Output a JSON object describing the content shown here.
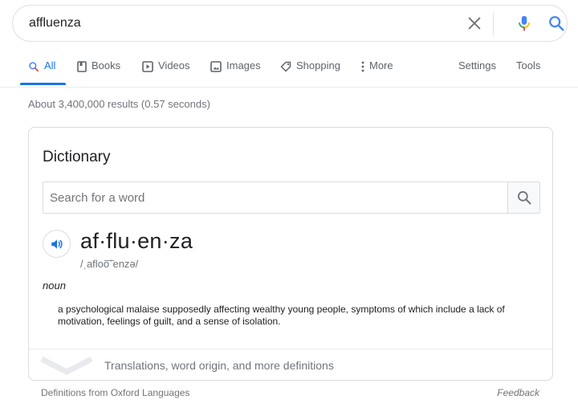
{
  "search": {
    "query": "affluenza"
  },
  "tabs": [
    {
      "label": "All",
      "icon": "search-icon",
      "active": true
    },
    {
      "label": "Books",
      "icon": "book-icon"
    },
    {
      "label": "Videos",
      "icon": "play-icon"
    },
    {
      "label": "Images",
      "icon": "image-icon"
    },
    {
      "label": "Shopping",
      "icon": "tag-icon"
    },
    {
      "label": "More",
      "icon": "more-vert-icon"
    }
  ],
  "tools": {
    "settings": "Settings",
    "tools": "Tools"
  },
  "stats": "About 3,400,000 results (0.57 seconds)",
  "dictionary": {
    "title": "Dictionary",
    "search_placeholder": "Search for a word",
    "headword": "af·flu·en·za",
    "pronunciation": "/ˌafloo͞ˈenzə/",
    "part_of_speech": "noun",
    "definition": "a psychological malaise supposedly affecting wealthy young people, symptoms of which include a lack of motivation, feelings of guilt, and a sense of isolation.",
    "more_label": "Translations, word origin, and more definitions"
  },
  "footer": {
    "source": "Definitions from Oxford Languages",
    "feedback": "Feedback"
  },
  "colors": {
    "accent": "#1a73e8",
    "mic_blue": "#4285f4",
    "mic_red": "#ea4335",
    "mic_yellow": "#fbbc05",
    "mic_green": "#34a853"
  }
}
